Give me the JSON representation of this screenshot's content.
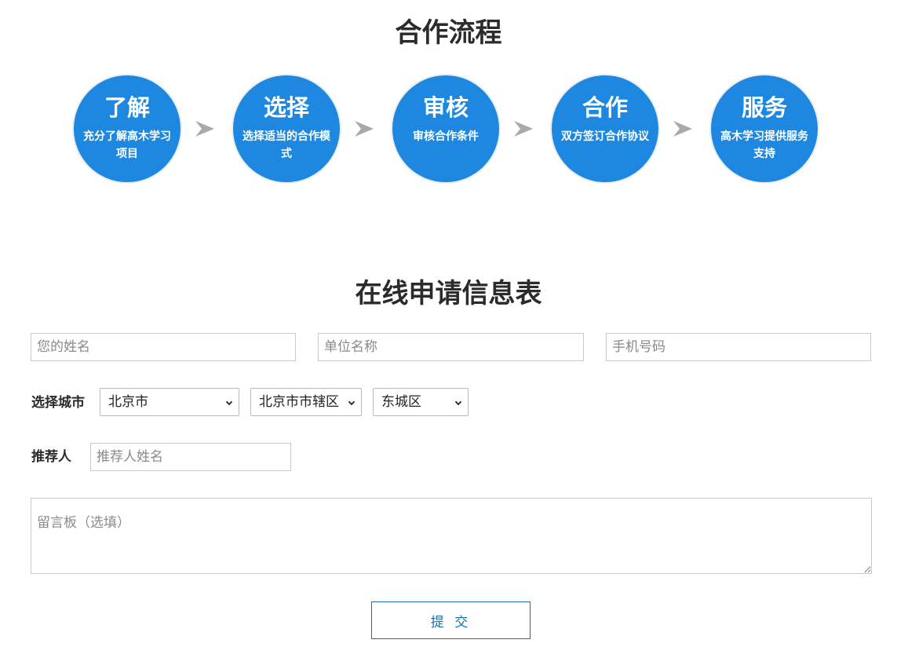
{
  "process": {
    "title": "合作流程",
    "steps": [
      {
        "title": "了解",
        "desc": "充分了解高木学习项目"
      },
      {
        "title": "选择",
        "desc": "选择适当的合作模式"
      },
      {
        "title": "审核",
        "desc": "审核合作条件"
      },
      {
        "title": "合作",
        "desc": "双方签订合作协议"
      },
      {
        "title": "服务",
        "desc": "高木学习提供服务支持"
      }
    ]
  },
  "form": {
    "title": "在线申请信息表",
    "name_placeholder": "您的姓名",
    "company_placeholder": "单位名称",
    "phone_placeholder": "手机号码",
    "city_label": "选择城市",
    "province_value": "北京市",
    "city_value": "北京市市辖区",
    "district_value": "东城区",
    "referrer_label": "推荐人",
    "referrer_placeholder": "推荐人姓名",
    "message_placeholder": "留言板（选填）",
    "submit_label": "提 交"
  },
  "colors": {
    "step_circle": "#1e88e0",
    "arrow": "#a9a9a9",
    "submit_text": "#1e6fa8"
  }
}
